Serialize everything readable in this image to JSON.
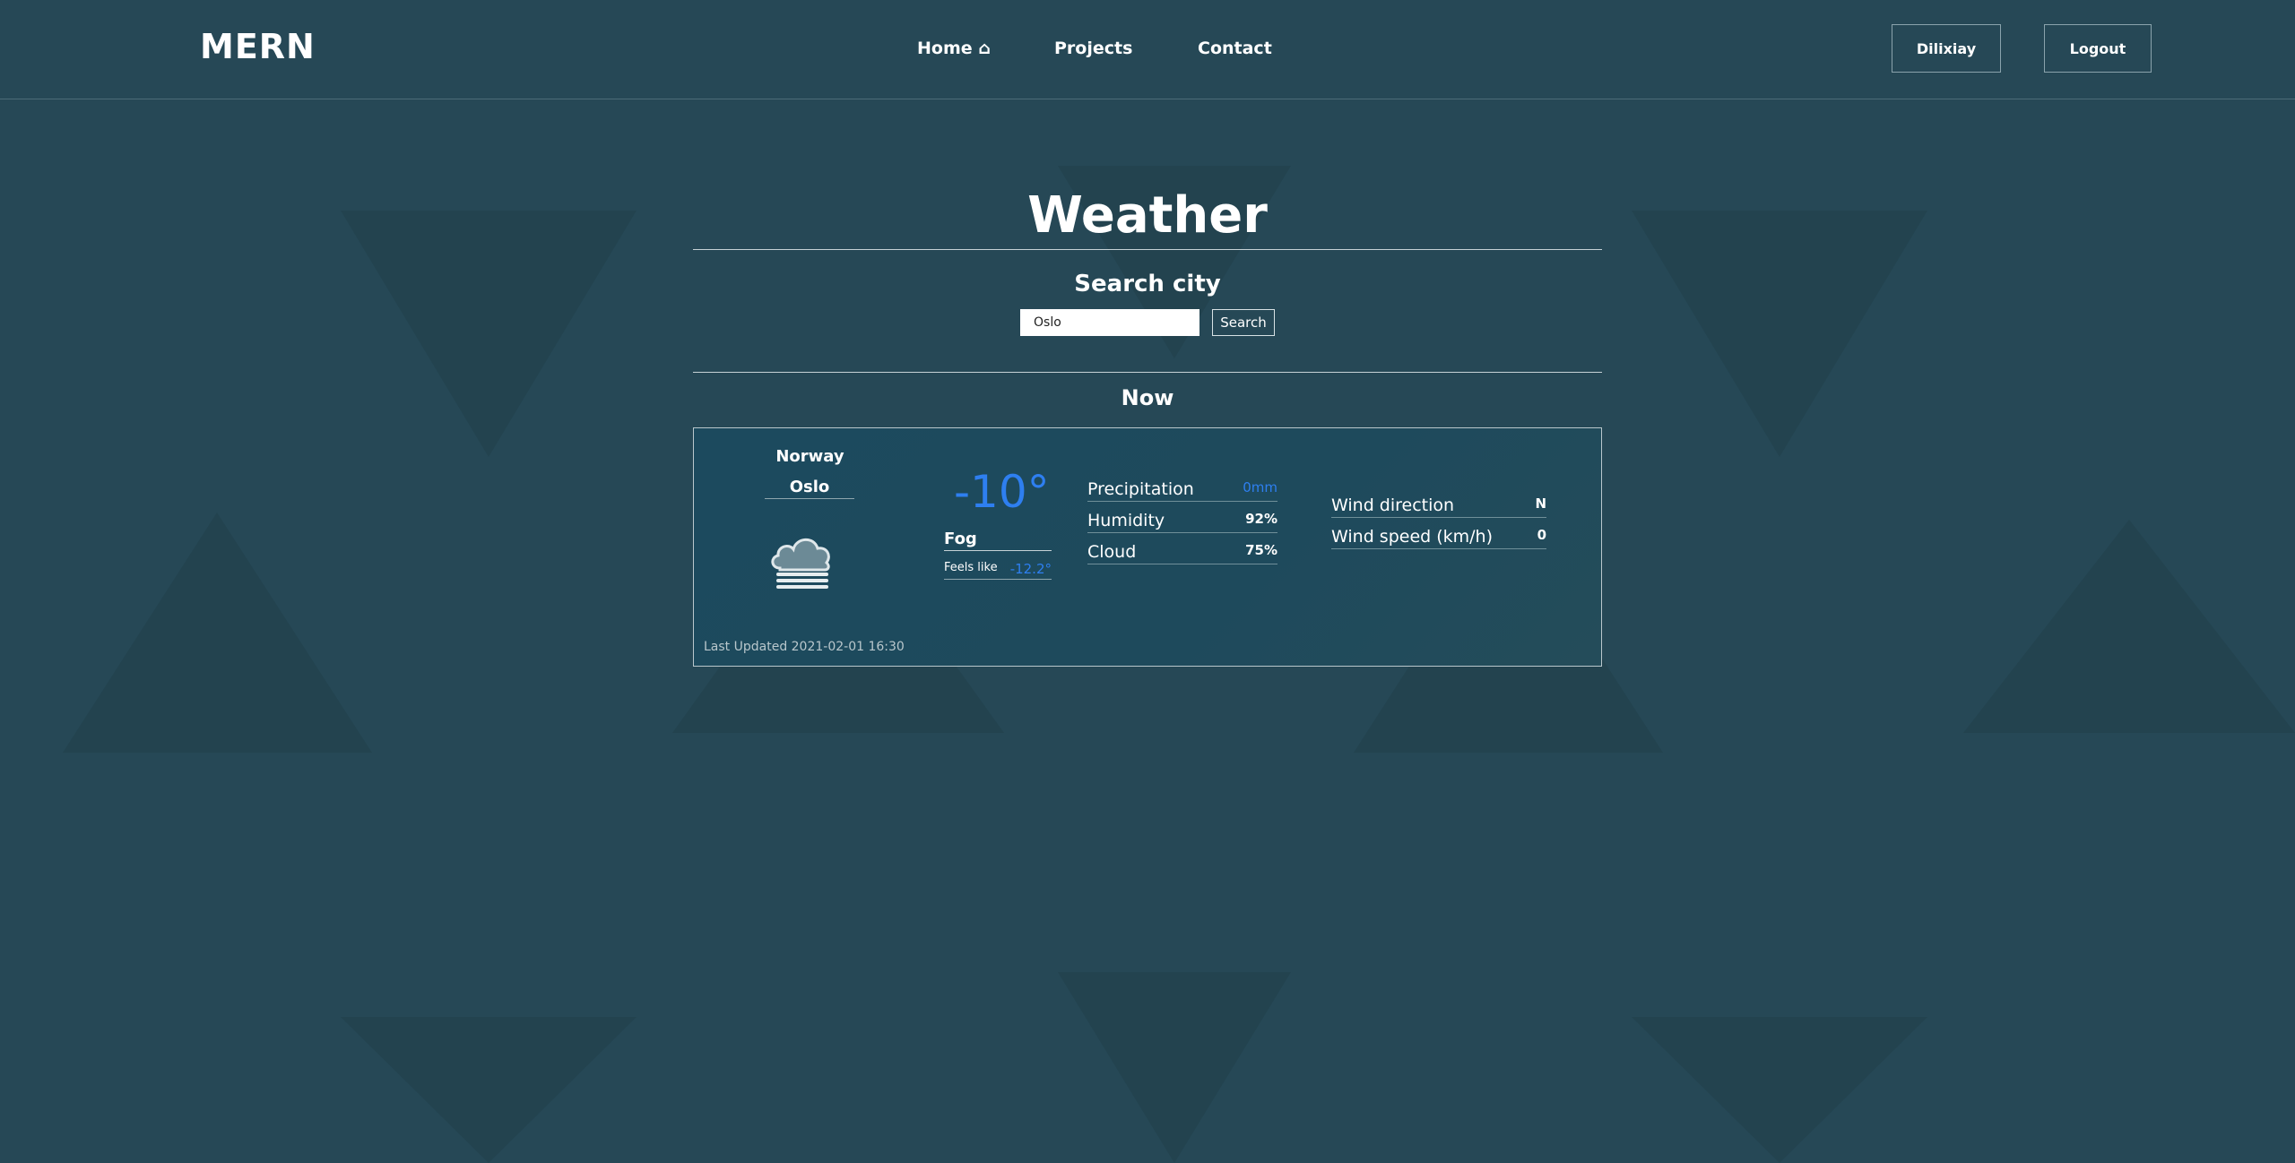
{
  "nav": {
    "logo": "MERN",
    "home": "Home ⌂",
    "projects": "Projects",
    "contact": "Contact",
    "user": "Dilixiay",
    "logout": "Logout"
  },
  "page": {
    "title": "Weather",
    "search_title": "Search city",
    "search_value": "Oslo",
    "search_button": "Search",
    "now_title": "Now"
  },
  "weather": {
    "country": "Norway",
    "city": "Oslo",
    "icon": "fog-cloud-icon",
    "temperature": "-10°",
    "condition": "Fog",
    "feels_like_label": "Feels like",
    "feels_like_value": "-12.2°",
    "stats": [
      {
        "label": "Precipitation",
        "value": "0mm"
      },
      {
        "label": "Humidity",
        "value": "92%"
      },
      {
        "label": "Cloud",
        "value": "75%"
      }
    ],
    "wind": [
      {
        "label": "Wind direction",
        "value": "N"
      },
      {
        "label": "Wind speed (km/h)",
        "value": "0"
      }
    ],
    "last_updated": "Last Updated 2021-02-01 16:30"
  },
  "colors": {
    "background": "#264856",
    "accent_blue": "#2e7ff0",
    "card": "#1c4a5e"
  }
}
